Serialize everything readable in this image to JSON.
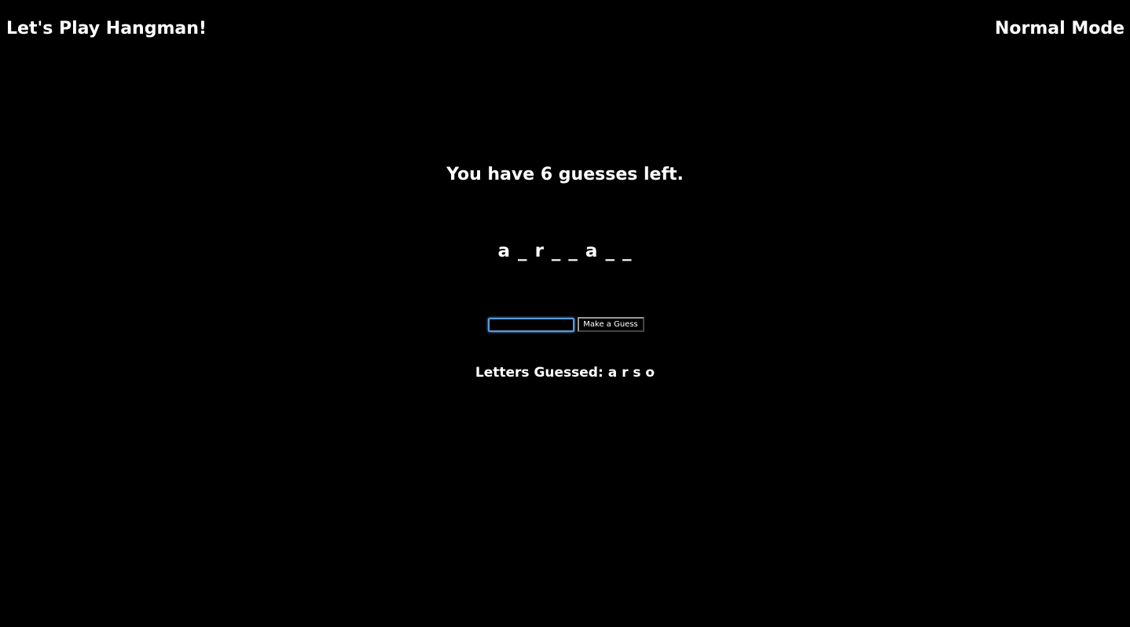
{
  "header": {
    "title": "Let's Play Hangman!",
    "mode": "Normal Mode"
  },
  "game": {
    "guesses_left_text": "You have 6 guesses left.",
    "word_display": "a _ r _ _ a _ _",
    "letters_guessed_text": "Letters Guessed: a r s o"
  },
  "form": {
    "input_value": "",
    "button_label": "Make a Guess"
  },
  "colors": {
    "background": "#000000",
    "text": "#ffffff",
    "input_focus_border": "#5b9bd8"
  }
}
